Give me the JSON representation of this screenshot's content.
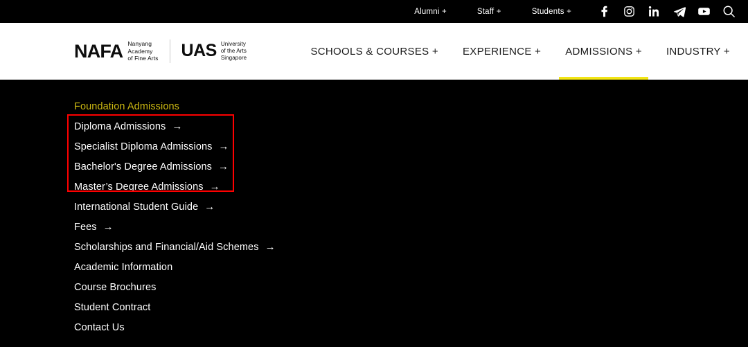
{
  "topbar": {
    "links": [
      {
        "label": "Alumni +",
        "name": "alumni"
      },
      {
        "label": "Staff +",
        "name": "staff"
      },
      {
        "label": "Students +",
        "name": "students"
      }
    ],
    "social": [
      {
        "icon": "facebook-icon",
        "title": "Facebook"
      },
      {
        "icon": "instagram-icon",
        "title": "Instagram"
      },
      {
        "icon": "linkedin-icon",
        "title": "LinkedIn"
      },
      {
        "icon": "telegram-icon",
        "title": "Telegram"
      },
      {
        "icon": "youtube-icon",
        "title": "YouTube"
      },
      {
        "icon": "search-icon",
        "title": "Search"
      }
    ]
  },
  "logo": {
    "nafa_mark": "NAFA",
    "nafa_line1": "Nanyang",
    "nafa_line2": "Academy",
    "nafa_line3": "of Fine Arts",
    "uas_mark": "UAS",
    "uas_line1": "University",
    "uas_line2": "of the Arts",
    "uas_line3": "Singapore"
  },
  "mainnav": {
    "items": [
      {
        "label": "SCHOOLS & COURSES +",
        "name": "schools-courses",
        "active": false
      },
      {
        "label": "EXPERIENCE +",
        "name": "experience",
        "active": false
      },
      {
        "label": "ADMISSIONS +",
        "name": "admissions",
        "active": true
      },
      {
        "label": "INDUSTRY +",
        "name": "industry",
        "active": false
      }
    ],
    "active_underline_color": "#F2E516"
  },
  "dropdown": {
    "items": [
      {
        "label": "Foundation Admissions",
        "arrow": "",
        "heading": true
      },
      {
        "label": "Diploma Admissions",
        "arrow": "→",
        "heading": false
      },
      {
        "label": "Specialist Diploma Admissions",
        "arrow": "→",
        "heading": false
      },
      {
        "label": "Bachelor's Degree Admissions",
        "arrow": "→",
        "heading": false
      },
      {
        "label": "Master’s Degree Admissions",
        "arrow": "→",
        "heading": false
      },
      {
        "label": "International Student Guide",
        "arrow": "→",
        "heading": false
      },
      {
        "label": "Fees",
        "arrow": "→",
        "heading": false
      },
      {
        "label": "Scholarships and Financial/Aid Schemes",
        "arrow": "→",
        "heading": false
      },
      {
        "label": "Academic Information",
        "arrow": "",
        "heading": false
      },
      {
        "label": "Course Brochures",
        "arrow": "",
        "heading": false
      },
      {
        "label": "Student Contract",
        "arrow": "",
        "heading": false
      },
      {
        "label": "Contact Us",
        "arrow": "",
        "heading": false
      }
    ],
    "heading_color": "#CDB912",
    "item_color": "#FFFFFF",
    "background": "#000000"
  },
  "annotation": {
    "color": "#FE0000",
    "encloses": [
      "Diploma Admissions",
      "Specialist Diploma Admissions",
      "Bachelor's Degree Admissions",
      "Master’s Degree Admissions"
    ]
  }
}
